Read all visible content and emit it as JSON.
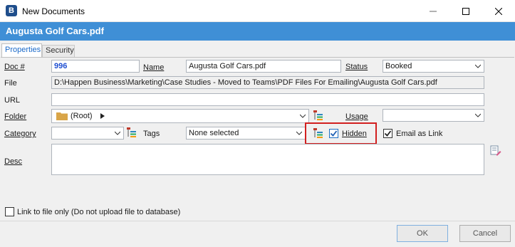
{
  "window": {
    "title": "New Documents",
    "app_icon_letter": "B"
  },
  "header": {
    "title": "Augusta Golf Cars.pdf"
  },
  "tabs": [
    {
      "label": "Properties",
      "active": true
    },
    {
      "label": "Security",
      "active": false
    }
  ],
  "form": {
    "doc_label": "Doc #",
    "doc_value": "996",
    "name_label": "Name",
    "name_value": "Augusta Golf Cars.pdf",
    "status_label": "Status",
    "status_value": "Booked",
    "file_label": "File",
    "file_value": "D:\\Happen Business\\Marketing\\Case Studies - Moved to Teams\\PDF Files For Emailing\\Augusta Golf Cars.pdf",
    "url_label": "URL",
    "url_value": "",
    "folder_label": "Folder",
    "folder_value": "(Root)",
    "usage_label": "Usage",
    "usage_value": "",
    "category_label": "Category",
    "category_value": "",
    "tags_label": "Tags",
    "tags_value": "None selected",
    "hidden_label": "Hidden",
    "hidden_checked": true,
    "email_link_label": "Email as Link",
    "email_link_checked": true,
    "desc_label": "Desc",
    "desc_value": "",
    "link_only_label": "Link to file only (Do not upload file to database)",
    "link_only_checked": false
  },
  "buttons": {
    "ok": "OK",
    "cancel": "Cancel"
  },
  "colors": {
    "header_band": "#3f8fd6",
    "doc_number": "#1f4fd1",
    "highlight_box": "#d21f1f",
    "active_tab_text": "#1b6ac9"
  }
}
